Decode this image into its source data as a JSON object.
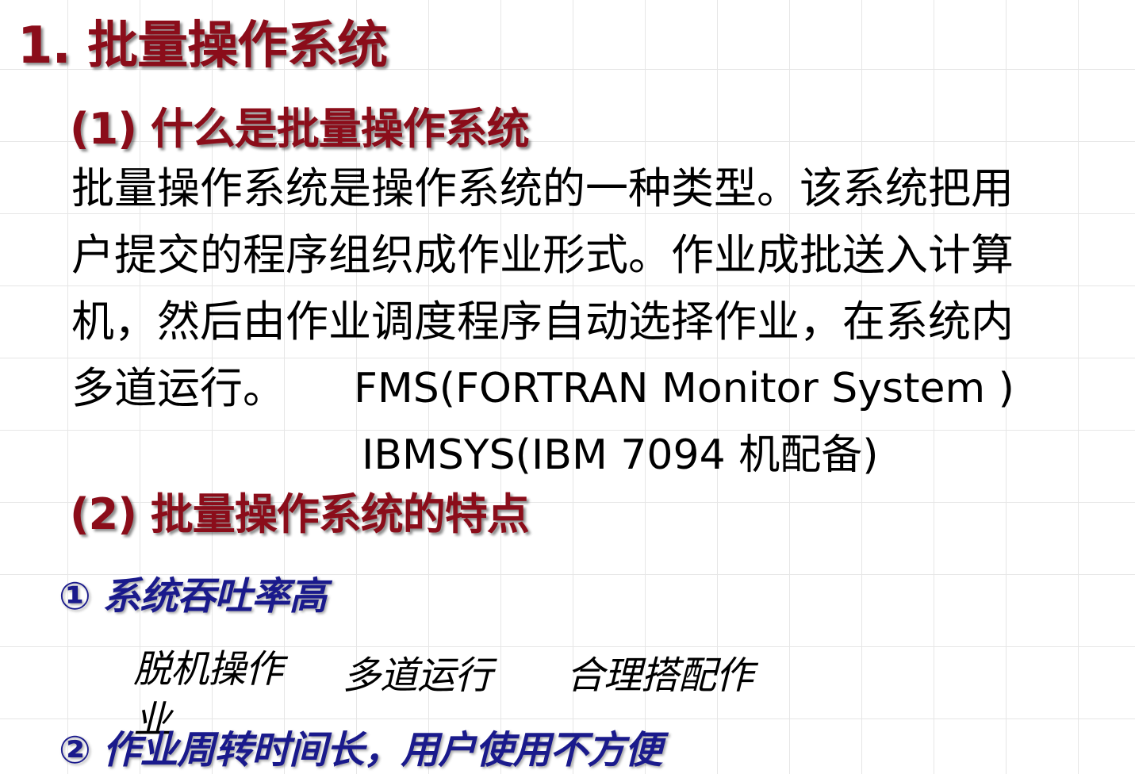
{
  "title": "1. 批量操作系统",
  "section1": {
    "heading": "(1) 什么是批量操作系统",
    "lines": [
      "批量操作系统是操作系统的一种类型。该系统把用",
      "户提交的程序组织成作业形式。作业成批送入计算",
      "机，然后由作业调度程序自动选择作业，在系统内",
      "多道运行。"
    ],
    "examples": [
      "FMS(FORTRAN Monitor System )",
      "IBMSYS(IBM  7094 机配备)"
    ]
  },
  "section2": {
    "heading": "(2) 批量操作系统的特点",
    "feature1": {
      "label": "① 系统吞吐率高",
      "sub_items": [
        "脱机操作业",
        "多道运行",
        "合理搭配作"
      ]
    },
    "feature2": {
      "label": "② 作业周转时间长，用户使用不方便"
    }
  }
}
